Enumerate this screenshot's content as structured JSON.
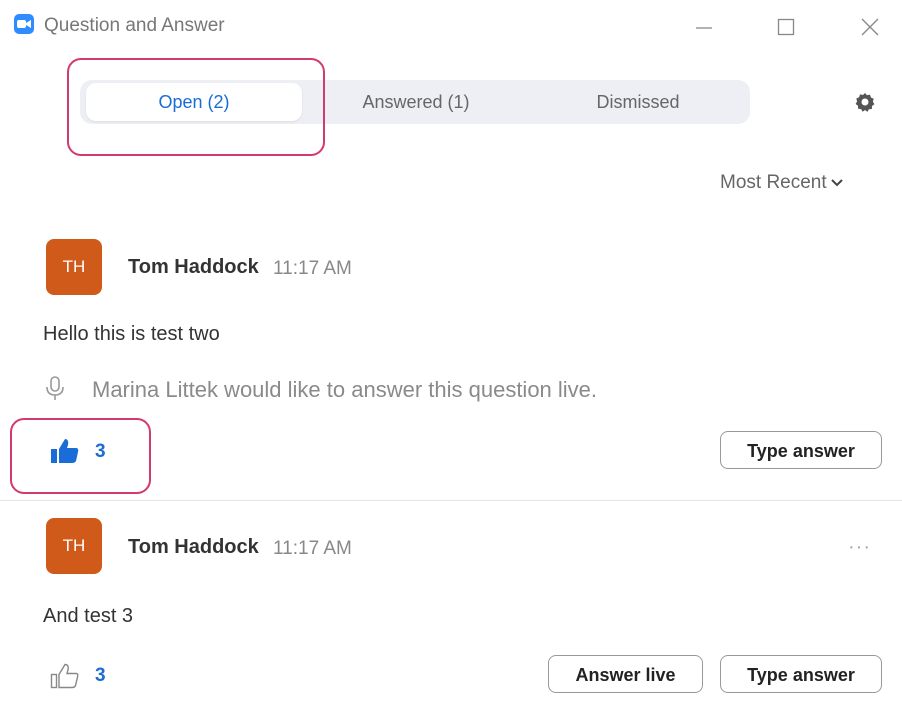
{
  "window": {
    "title": "Question and Answer"
  },
  "tabs": [
    {
      "label": "Open (2)",
      "active": true
    },
    {
      "label": "Answered (1)",
      "active": false
    },
    {
      "label": "Dismissed",
      "active": false
    }
  ],
  "sort": {
    "label": "Most Recent"
  },
  "questions": [
    {
      "avatar_initials": "TH",
      "author": "Tom Haddock",
      "time": "11:17 AM",
      "text": "Hello this is test two",
      "live_note": "Marina Littek would like to answer this question live.",
      "likes": "3",
      "liked": true,
      "type_answer_label": "Type answer"
    },
    {
      "avatar_initials": "TH",
      "author": "Tom Haddock",
      "time": "11:17 AM",
      "text": "And test 3",
      "likes": "3",
      "liked": false,
      "more_label": "···",
      "answer_live_label": "Answer live",
      "type_answer_label": "Type answer"
    }
  ],
  "colors": {
    "accent": "#1a6cd6",
    "avatar": "#d05a1a",
    "highlight": "#d23a6f",
    "app_icon": "#2d8cff"
  }
}
